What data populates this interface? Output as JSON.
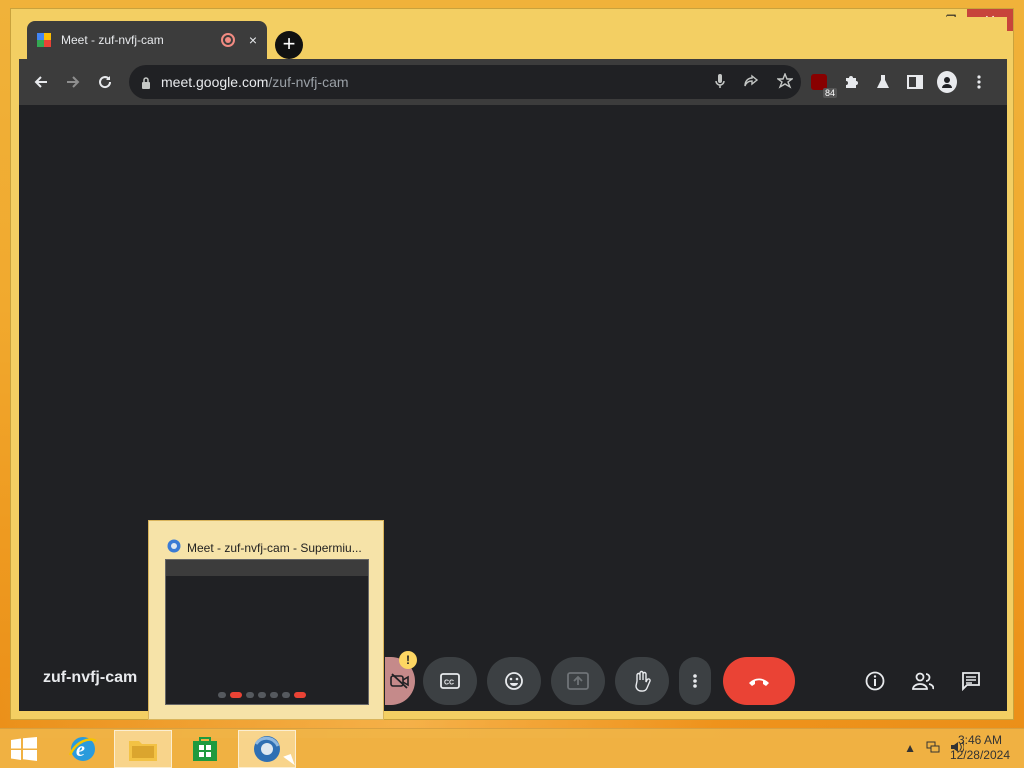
{
  "browser": {
    "tab_title": "Meet - zuf-nvfj-cam",
    "tab_close": "×",
    "new_tab": "+",
    "url_domain": "meet.google.com",
    "url_path": "/zuf-nvfj-cam",
    "extension_badge": "84"
  },
  "window_controls": {
    "minimize": "▬",
    "restore": "❐",
    "close": "✕",
    "chevron": "⌵"
  },
  "meet": {
    "meeting_code": "zuf-nvfj-cam",
    "warning_badge": "!"
  },
  "preview": {
    "title": "Meet - zuf-nvfj-cam - Supermiu..."
  },
  "taskbar": {
    "time": "3:46 AM",
    "date": "12/28/2024"
  },
  "colors": {
    "window_frame": "#f3cf63",
    "chrome_dark": "#202124",
    "hangup_red": "#ea4335"
  }
}
